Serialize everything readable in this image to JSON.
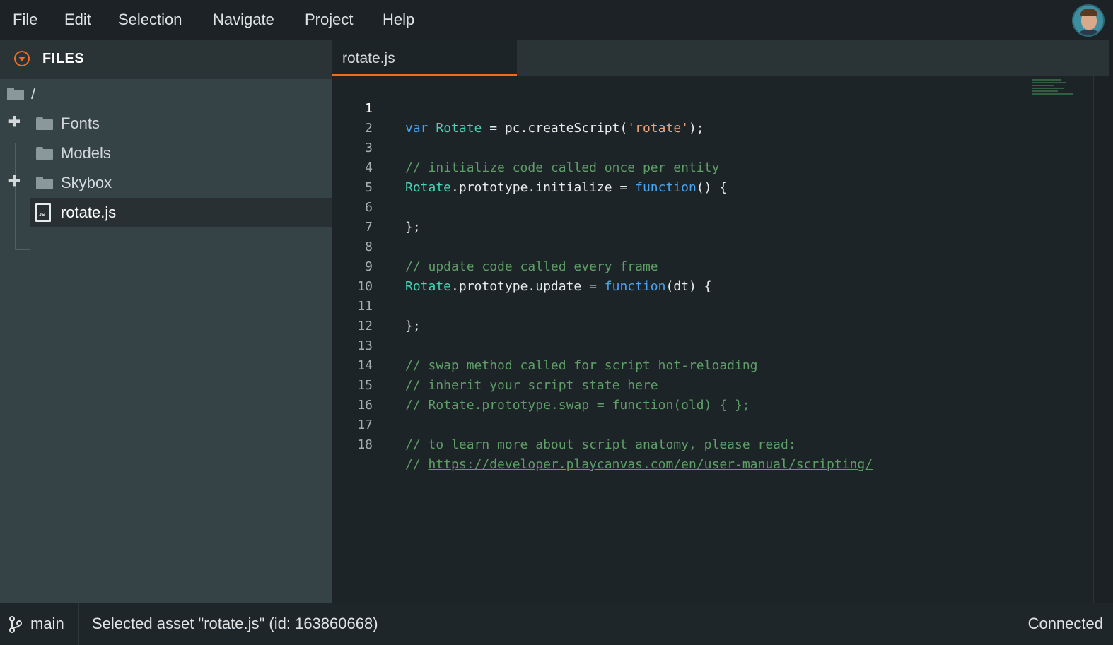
{
  "menu": {
    "items": [
      "File",
      "Edit",
      "Selection",
      "Navigate",
      "Project",
      "Help"
    ]
  },
  "sidebar": {
    "title": "FILES",
    "root": "/",
    "items": [
      {
        "label": "Fonts",
        "type": "folder",
        "expandable": true
      },
      {
        "label": "Models",
        "type": "folder",
        "expandable": false
      },
      {
        "label": "Skybox",
        "type": "folder",
        "expandable": true
      },
      {
        "label": "rotate.js",
        "type": "file",
        "badge": "JS",
        "selected": true
      }
    ]
  },
  "editor": {
    "tab_label": "rotate.js",
    "active_line": 1,
    "lines": [
      {
        "n": "1"
      },
      {
        "n": "2"
      },
      {
        "n": "3"
      },
      {
        "n": "4"
      },
      {
        "n": "5"
      },
      {
        "n": "6"
      },
      {
        "n": "7"
      },
      {
        "n": "8"
      },
      {
        "n": "9"
      },
      {
        "n": "10"
      },
      {
        "n": "11"
      },
      {
        "n": "12"
      },
      {
        "n": "13"
      },
      {
        "n": "14"
      },
      {
        "n": "15"
      },
      {
        "n": "16"
      },
      {
        "n": "17"
      },
      {
        "n": "18"
      }
    ],
    "code": {
      "l1": {
        "kw": "var",
        "cls": "Rotate",
        "mid": " = pc.createScript(",
        "str": "'rotate'",
        "end": ");"
      },
      "l3": "// initialize code called once per entity",
      "l4": {
        "cls": "Rotate",
        "mid": ".prototype.initialize = ",
        "kw": "function",
        "end": "() {"
      },
      "l6": "};",
      "l8": "// update code called every frame",
      "l9": {
        "cls": "Rotate",
        "mid": ".prototype.update = ",
        "kw": "function",
        "end": "(dt) {"
      },
      "l11": "};",
      "l13": "// swap method called for script hot-reloading",
      "l14": "// inherit your script state here",
      "l15": "// Rotate.prototype.swap = function(old) { };",
      "l17": "// to learn more about script anatomy, please read:",
      "l18": {
        "prefix": "// ",
        "url": "https://developer.playcanvas.com/en/user-manual/scripting/"
      }
    }
  },
  "status": {
    "branch": "main",
    "message": "Selected asset \"rotate.js\" (id: 163860668)",
    "connection": "Connected"
  },
  "colors": {
    "accent": "#f26b21",
    "keyword": "#4aa3f0",
    "class_name": "#44d3b4",
    "string": "#e8a27a",
    "comment": "#5e9e67"
  }
}
